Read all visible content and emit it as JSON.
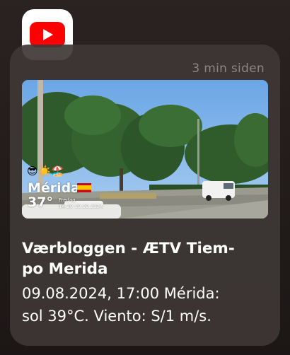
{
  "app": {
    "icon": "youtube-play-icon",
    "brand_color": "#ff0000"
  },
  "notification": {
    "time": "3 min siden",
    "thumbnail": {
      "emoji": "😎☀️🏖️",
      "city": "Mérida",
      "temp": "37°",
      "day": "Fredag",
      "timestamp": "14:38 09.08.2024"
    },
    "title_line1": "Værbloggen - ÆTV Tiem-",
    "title_line2": "po Merida",
    "body_line1": "09.08.2024, 17:00 Mérida:",
    "body_line2": "sol 39°C. Viento: S/1 m/s."
  },
  "colors": {
    "card": "#3e3736",
    "secondary_text": "#8d8584"
  }
}
